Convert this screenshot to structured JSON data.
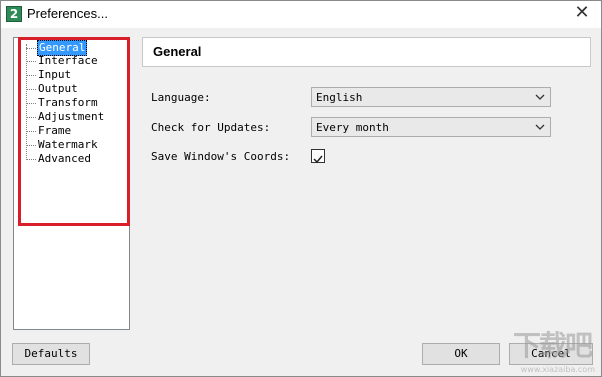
{
  "window": {
    "title": "Preferences...",
    "app_icon_text": "2",
    "close_glyph": "✕"
  },
  "sidebar": {
    "items": [
      {
        "label": "General",
        "selected": true
      },
      {
        "label": "Interface"
      },
      {
        "label": "Input"
      },
      {
        "label": "Output"
      },
      {
        "label": "Transform"
      },
      {
        "label": "Adjustment"
      },
      {
        "label": "Frame"
      },
      {
        "label": "Watermark"
      },
      {
        "label": "Advanced"
      }
    ]
  },
  "panel": {
    "title": "General",
    "language": {
      "label": "Language:",
      "value": "English"
    },
    "updates": {
      "label": "Check for Updates:",
      "value": "Every month"
    },
    "save_coords": {
      "label": "Save Window's Coords:",
      "checked": true
    }
  },
  "buttons": {
    "defaults": "Defaults",
    "ok": "OK",
    "cancel": "Cancel"
  },
  "watermark": {
    "text": "下载吧",
    "sub": "www.xiazaiba.com"
  },
  "colors": {
    "highlight": "#d9202a",
    "selection": "#3399ff"
  }
}
